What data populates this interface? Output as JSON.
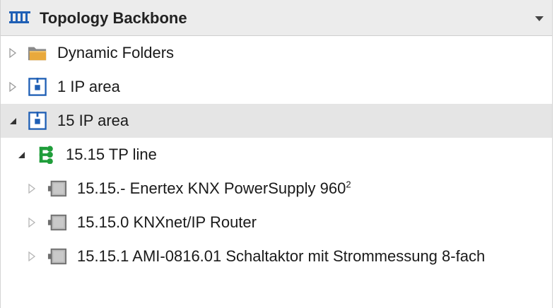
{
  "header": {
    "title": "Topology Backbone",
    "icon": "topology-icon",
    "menu_icon": "chevron-down-icon"
  },
  "tree": {
    "dynamic_folders": {
      "label": "Dynamic Folders",
      "icon": "folder-icon",
      "expanded": false
    },
    "area_1": {
      "label": "1 IP area",
      "icon": "area-icon",
      "expanded": false
    },
    "area_15": {
      "label": "15 IP area",
      "icon": "area-icon",
      "expanded": true,
      "selected": true
    },
    "line_15_15": {
      "label": "15.15 TP line",
      "icon": "line-icon",
      "expanded": true
    },
    "devices": [
      {
        "label": "15.15.- Enertex KNX PowerSupply 960",
        "superscript": "2",
        "icon": "device-icon"
      },
      {
        "label": "15.15.0 KNXnet/IP Router",
        "superscript": "",
        "icon": "device-icon"
      },
      {
        "label": "15.15.1 AMI-0816.01 Schaltaktor mit Strommessung 8-fach",
        "superscript": "",
        "icon": "device-icon"
      }
    ]
  },
  "colors": {
    "accent_blue": "#1f5fb5",
    "line_green": "#1f9d3a",
    "folder_orange": "#e9a93c",
    "selected_bg": "#e5e5e5",
    "header_bg": "#ececec"
  }
}
